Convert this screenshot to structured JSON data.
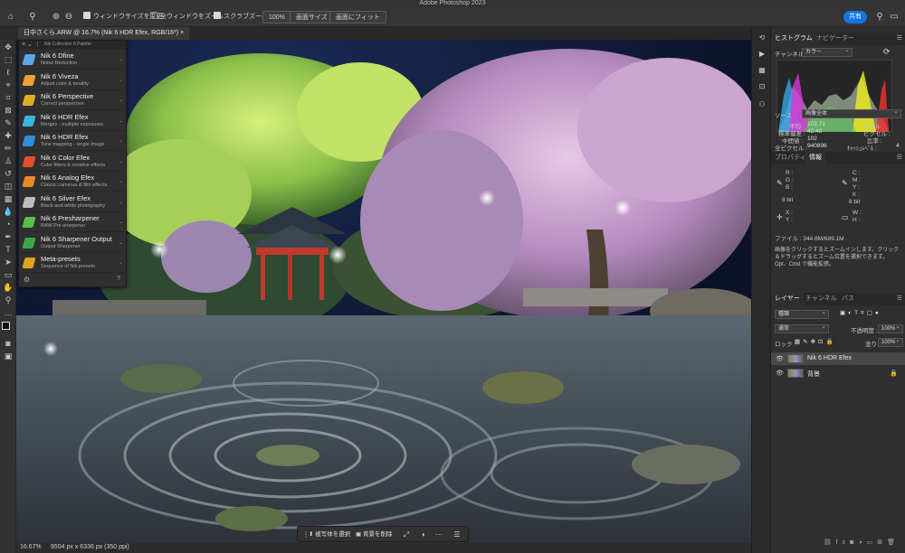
{
  "app_title": "Adobe Photoshop 2023",
  "options_bar": {
    "resize_windows": "ウィンドウサイズを変更",
    "zoom_all": "全ウィンドウをズーム",
    "scrubby_zoom": "スクラブズーム",
    "zoom_100": "100%",
    "fit_screen": "画面サイズ",
    "fill_screen": "画面にフィット",
    "share": "共有"
  },
  "document_tab": "日中さくら.ARW @ 16.7% (Nik 6 HDR Efex, RGB/16*) ×",
  "nik_palette": {
    "title": "Nik Collection 6 Palette",
    "items": [
      {
        "name": "Nik 6 Dfine",
        "desc": "Noise Reduction",
        "color": "#5aa7e6"
      },
      {
        "name": "Nik 6 Viveza",
        "desc": "Adjust color & tonality",
        "color": "#f0a030"
      },
      {
        "name": "Nik 6 Perspective",
        "desc": "Correct perspective",
        "color": "#e0b020"
      },
      {
        "name": "Nik 6 HDR Efex",
        "desc": "Merges - multiple exposures",
        "color": "#39b6e0"
      },
      {
        "name": "Nik 6 HDR Efex",
        "desc": "Tone mapping - single image",
        "color": "#2f8fd8"
      },
      {
        "name": "Nik 6 Color Efex",
        "desc": "Color filters & creative effects",
        "color": "#e5502a"
      },
      {
        "name": "Nik 6 Analog Efex",
        "desc": "Classic cameras & film effects",
        "color": "#e88a2a"
      },
      {
        "name": "Nik 6 Silver Efex",
        "desc": "Black-and-white photography",
        "color": "#bdbdbd"
      },
      {
        "name": "Nik 6 Presharpener",
        "desc": "RAW Pre-sharpener",
        "color": "#5cc04a"
      },
      {
        "name": "Nik 6 Sharpener Output",
        "desc": "Output Sharpener",
        "color": "#3aa84a"
      },
      {
        "name": "Meta-presets",
        "desc": "Sequence of Nik presets",
        "color": "#e0a020"
      }
    ]
  },
  "status": {
    "zoom": "16.67%",
    "size": "9504 px x 6336 px (350 ppi)"
  },
  "context_bar": {
    "select_subject": "被写体を選択",
    "remove_bg": "背景を削除"
  },
  "histogram_panel": {
    "tab_histogram": "ヒストグラム",
    "tab_navigator": "ナビゲーター",
    "channel_label": "チャンネル :",
    "channel_value": "カラー",
    "source_label": "ソース :",
    "source_value": "画像全体",
    "mean_label": "平均 :",
    "mean_value": "102.71",
    "std_label": "標準偏差 :",
    "std_value": "42.40",
    "median_label": "中間値 :",
    "median_value": "102",
    "pixels_label": "全ピクセル :",
    "pixels_value": "940896",
    "level_label": "レベル :",
    "count_label": "ピクセル :",
    "percentile_label": "比率 :",
    "cache_label": "ｷｬｯｼｭﾚﾍﾞﾙ :",
    "cache_value": "4"
  },
  "info_panel": {
    "tab_properties": "プロパティ",
    "tab_info": "情報",
    "r": "R :",
    "g": "G :",
    "b": "B :",
    "c": "C :",
    "m": "M :",
    "y": "Y :",
    "k": "K :",
    "bit1": "8 bit",
    "bit2": "8 bit",
    "x": "X :",
    "yy": "Y :",
    "w": "W :",
    "h": "H :",
    "file": "ファイル : 344.6M/689.1M",
    "hint": "画像をクリックするとズームインします。クリック＆ドラッグするとズーム位置を選択できます。Opt、Cmd で機能拡張。"
  },
  "layers_panel": {
    "tab_layers": "レイヤー",
    "tab_channels": "チャンネル",
    "tab_paths": "パス",
    "filter_kind": "種類",
    "blend_mode": "通常",
    "opacity_label": "不透明度 :",
    "opacity_value": "100%",
    "lock_label": "ロック :",
    "fill_label": "塗り :",
    "fill_value": "100%",
    "layers": [
      {
        "name": "Nik 6 HDR Efex",
        "selected": true
      },
      {
        "name": "背景",
        "selected": false
      }
    ]
  }
}
